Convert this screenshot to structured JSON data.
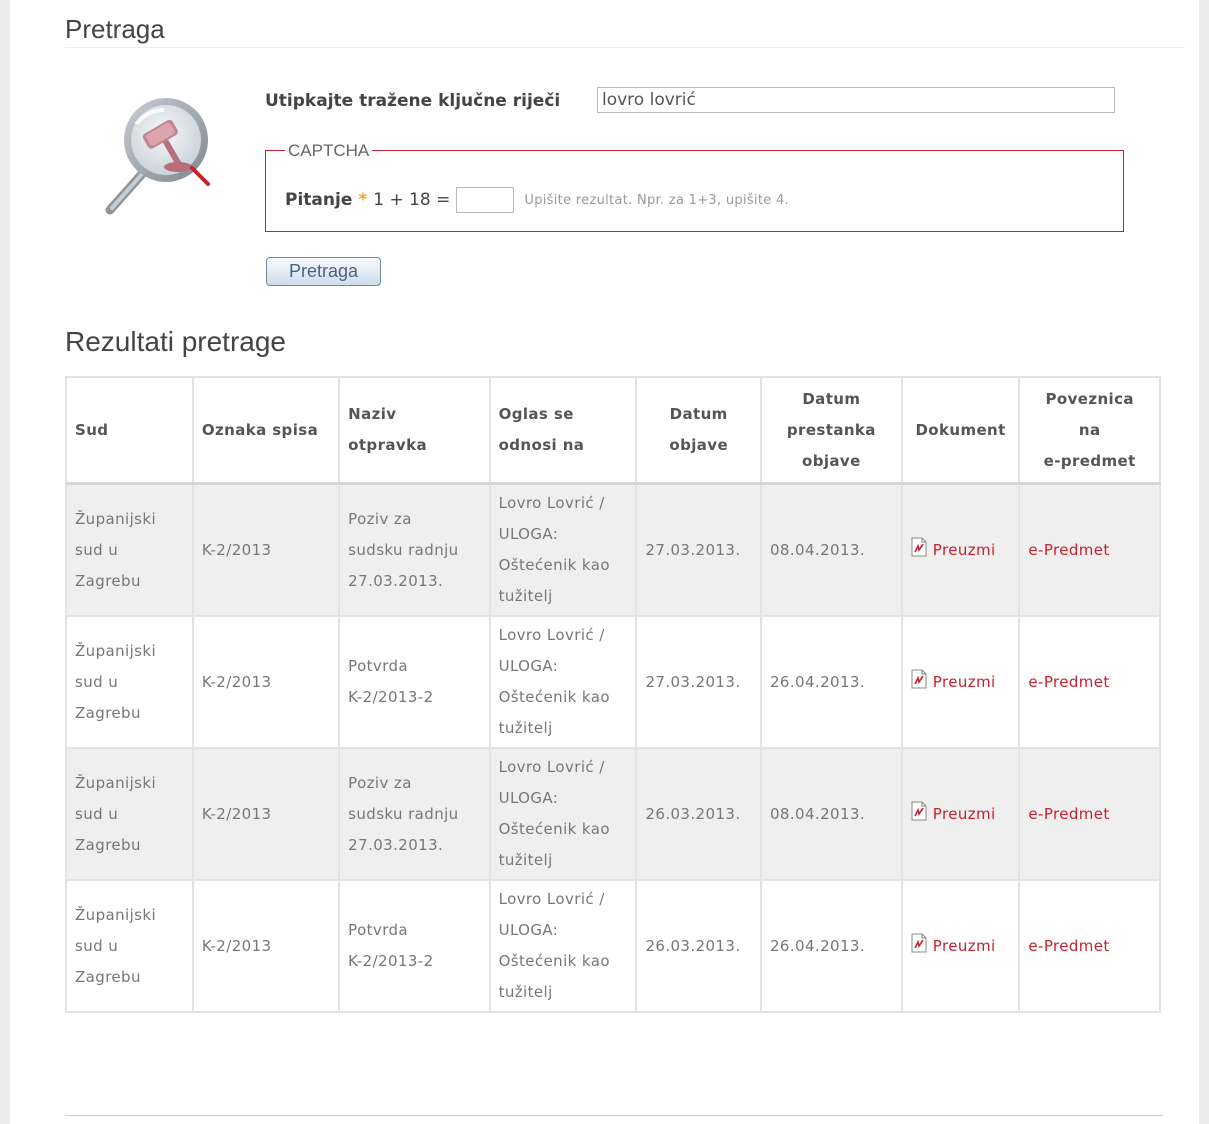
{
  "page": {
    "title": "Pretraga"
  },
  "search": {
    "keyword_label": "Utipkajte tražene ključne riječi",
    "keyword_value": "lovro lovrić",
    "captcha_legend": "CAPTCHA",
    "captcha_question_label": "Pitanje",
    "captcha_required_mark": "*",
    "captcha_expression": "1 + 18 =",
    "captcha_hint": "Upišite rezultat. Npr. za 1+3, upišite 4.",
    "button_label": "Pretraga"
  },
  "results": {
    "title": "Rezultati pretrage",
    "columns": {
      "sud": "Sud",
      "oznaka": "Oznaka spisa",
      "naziv_1": "Naziv",
      "naziv_2": "otpravka",
      "oglas_1": "Oglas se",
      "oglas_2": "odnosi na",
      "datum_1": "Datum",
      "datum_2": "objave",
      "prest_1": "Datum",
      "prest_2": "prestanka",
      "prest_3": "objave",
      "dokument": "Dokument",
      "pov_1": "Poveznica",
      "pov_2": "na",
      "pov_3": "e-predmet"
    },
    "rows": [
      {
        "sud": [
          "Županijski",
          "sud u",
          "Zagrebu"
        ],
        "oznaka": "K-2/2013",
        "naziv": [
          "Poziv za",
          "sudsku radnju",
          "27.03.2013."
        ],
        "oglas": [
          "Lovro Lovrić /",
          "ULOGA:",
          "Oštećenik kao",
          "tužitelj"
        ],
        "datum": "27.03.2013.",
        "prestanak": "08.04.2013.",
        "dokument": "Preuzmi",
        "poveznica": "e-Predmet"
      },
      {
        "sud": [
          "Županijski",
          "sud u",
          "Zagrebu"
        ],
        "oznaka": "K-2/2013",
        "naziv": [
          "Potvrda",
          "K-2/2013-2"
        ],
        "oglas": [
          "Lovro Lovrić /",
          "ULOGA:",
          "Oštećenik kao",
          "tužitelj"
        ],
        "datum": "27.03.2013.",
        "prestanak": "26.04.2013.",
        "dokument": "Preuzmi",
        "poveznica": "e-Predmet"
      },
      {
        "sud": [
          "Županijski",
          "sud u",
          "Zagrebu"
        ],
        "oznaka": "K-2/2013",
        "naziv": [
          "Poziv za",
          "sudsku radnju",
          "27.03.2013."
        ],
        "oglas": [
          "Lovro Lovrić /",
          "ULOGA:",
          "Oštećenik kao",
          "tužitelj"
        ],
        "datum": "26.03.2013.",
        "prestanak": "08.04.2013.",
        "dokument": "Preuzmi",
        "poveznica": "e-Predmet"
      },
      {
        "sud": [
          "Županijski",
          "sud u",
          "Zagrebu"
        ],
        "oznaka": "K-2/2013",
        "naziv": [
          "Potvrda",
          "K-2/2013-2"
        ],
        "oglas": [
          "Lovro Lovrić /",
          "ULOGA:",
          "Oštećenik kao",
          "tužitelj"
        ],
        "datum": "26.03.2013.",
        "prestanak": "26.04.2013.",
        "dokument": "Preuzmi",
        "poveznica": "e-Predmet"
      }
    ]
  },
  "colors": {
    "accent_red": "#c6212f",
    "required_star": "#f4a833",
    "row_alt": "#efefef"
  },
  "icons": {
    "search_graphic": "magnifier-gavel-icon",
    "document": "pdf-icon"
  }
}
